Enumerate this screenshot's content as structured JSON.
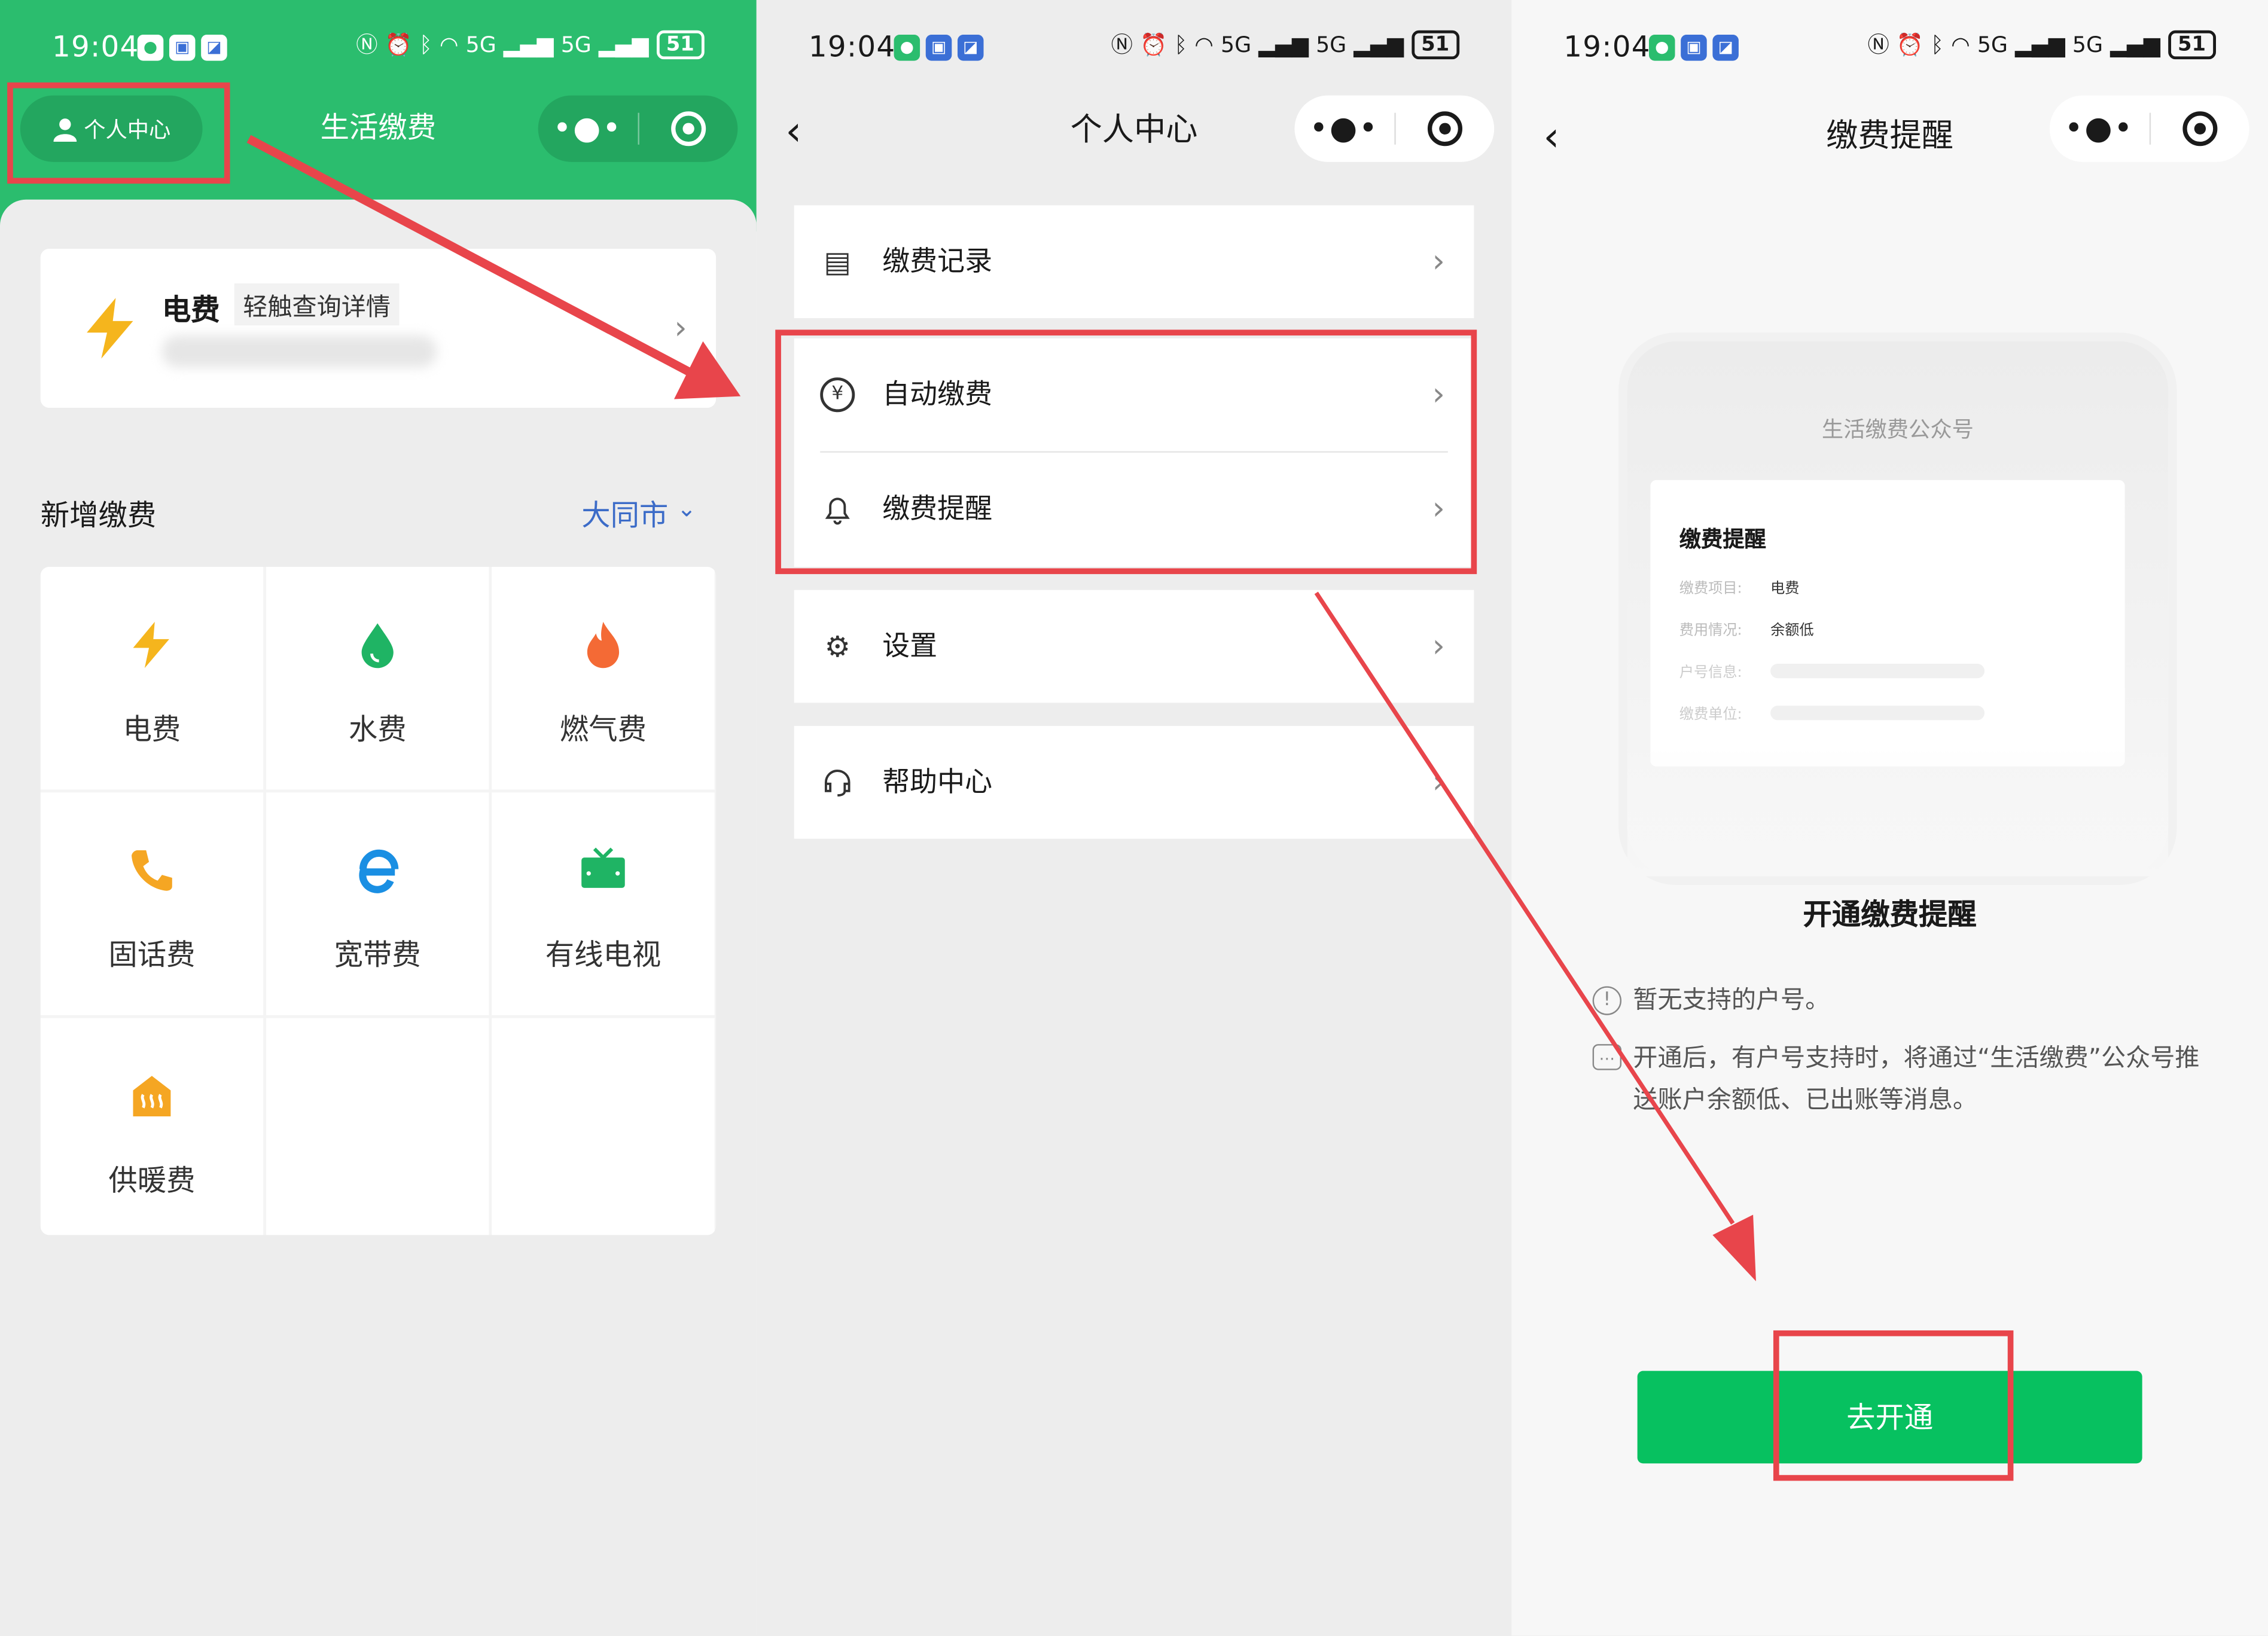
{
  "status": {
    "time": "19:04",
    "network": "5G",
    "network2": "5G",
    "battery": "51"
  },
  "panel1": {
    "personal_button": "个人中心",
    "title": "生活缴费",
    "bill_card": {
      "title": "电费",
      "tag": "轻触查询详情"
    },
    "section_title": "新增缴费",
    "city": "大同市",
    "categories": [
      {
        "label": "电费",
        "icon": "lightning-icon",
        "color": "#f5b51d"
      },
      {
        "label": "水费",
        "icon": "water-drop-icon",
        "color": "#1fb464"
      },
      {
        "label": "燃气费",
        "icon": "flame-icon",
        "color": "#f46a35"
      },
      {
        "label": "固话费",
        "icon": "phone-icon",
        "color": "#f5a623"
      },
      {
        "label": "宽带费",
        "icon": "broadband-icon",
        "color": "#1a8fe3"
      },
      {
        "label": "有线电视",
        "icon": "tv-icon",
        "color": "#1fb464"
      },
      {
        "label": "供暖费",
        "icon": "heating-icon",
        "color": "#f5a623"
      }
    ]
  },
  "panel2": {
    "title": "个人中心",
    "menu": [
      {
        "label": "缴费记录",
        "icon": "record-icon"
      },
      {
        "label": "自动缴费",
        "icon": "yuan-icon"
      },
      {
        "label": "缴费提醒",
        "icon": "bell-icon"
      },
      {
        "label": "设置",
        "icon": "gear-icon"
      },
      {
        "label": "帮助中心",
        "icon": "headset-icon"
      }
    ]
  },
  "panel3": {
    "title": "缴费提醒",
    "preview": {
      "account": "生活缴费公众号",
      "heading": "缴费提醒",
      "rows": [
        {
          "key": "缴费项目:",
          "value": "电费"
        },
        {
          "key": "费用情况:",
          "value": "余额低"
        },
        {
          "key": "户号信息:",
          "value": ""
        },
        {
          "key": "缴费单位:",
          "value": ""
        }
      ]
    },
    "subtitle": "开通缴费提醒",
    "notes": [
      {
        "icon": "info-icon",
        "text": "暂无支持的户号。"
      },
      {
        "icon": "message-icon",
        "text": "开通后，有户号支持时，将通过“生活缴费”公众号推送账户余额低、已出账等消息。"
      }
    ],
    "button": "去开通"
  },
  "colors": {
    "brand_green": "#2bbd6e",
    "button_green": "#07c160",
    "annotation_red": "#e8454b"
  }
}
